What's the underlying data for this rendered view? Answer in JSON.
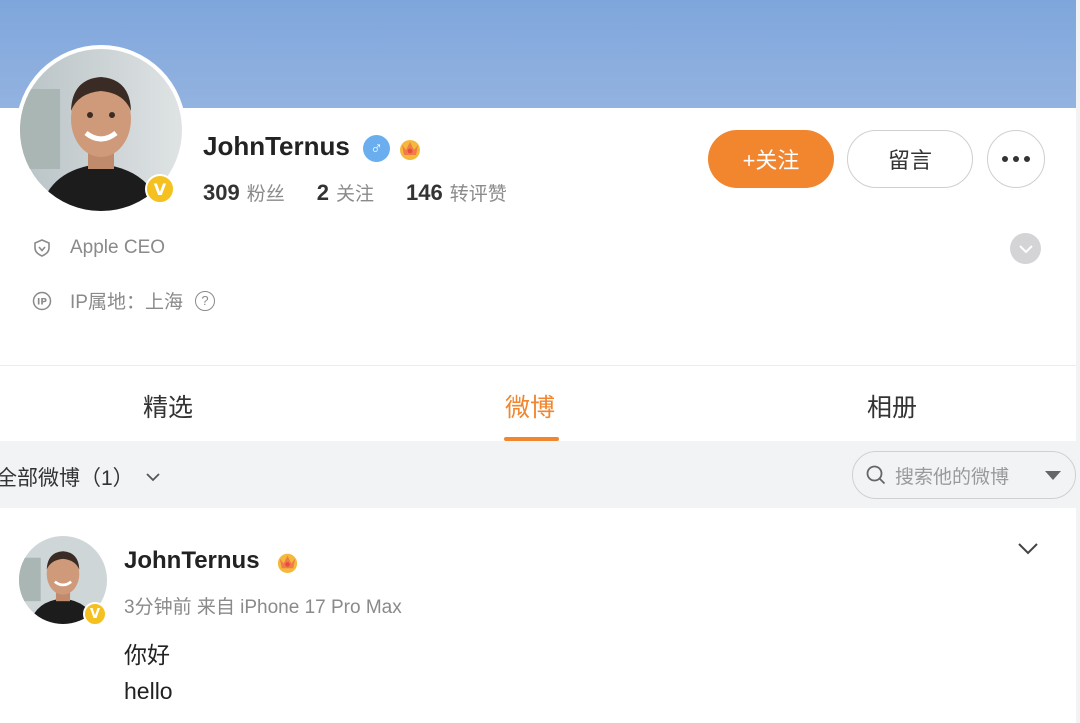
{
  "profile": {
    "name": "JohnTernus",
    "gender_symbol": "♂",
    "verified_badge": "V",
    "stats": [
      {
        "num": "309",
        "label": "粉丝"
      },
      {
        "num": "2",
        "label": "关注"
      },
      {
        "num": "146",
        "label": "转评赞"
      }
    ],
    "description": "Apple CEO",
    "ip_location": "IP属地：上海",
    "help_symbol": "?"
  },
  "actions": {
    "follow_label": "+关注",
    "message_label": "留言"
  },
  "tabs": [
    {
      "label": "精选"
    },
    {
      "label": "微博"
    },
    {
      "label": "相册"
    }
  ],
  "filter": {
    "label": "全部微博（1）",
    "search_placeholder": "搜索他的微博"
  },
  "post": {
    "author": "JohnTernus",
    "meta": "3分钟前  来自 iPhone 17 Pro Max",
    "lines": [
      "你好",
      "hello"
    ]
  },
  "colors": {
    "accent": "#f1862e",
    "banner": "#8aaede",
    "verified": "#f4c121",
    "male": "#6aaef0"
  },
  "icons": [
    "male-icon",
    "crown-icon",
    "shield-icon",
    "ip-icon",
    "help-icon",
    "chevron-down-icon",
    "search-icon",
    "more-icon",
    "verified-badge-icon"
  ]
}
